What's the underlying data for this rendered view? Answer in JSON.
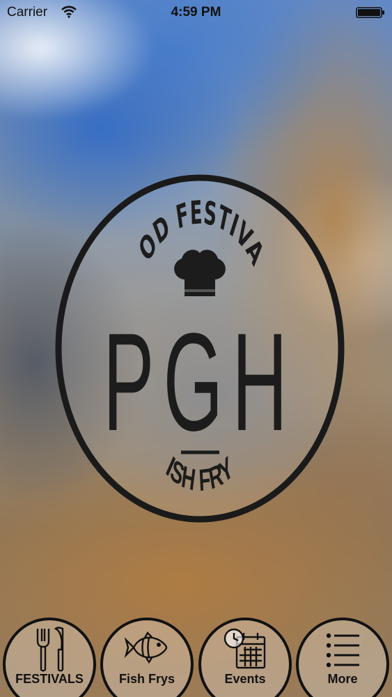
{
  "status_bar": {
    "carrier": "Carrier",
    "time": "4:59 PM",
    "wifi_icon": "wifi-icon",
    "battery_icon": "battery-full-icon"
  },
  "logo": {
    "top_text": "FOOD FESTIVALS",
    "main_text": "PGH",
    "bottom_text": "FISH FRYS",
    "icon": "chef-hat-icon"
  },
  "tab_bar": {
    "tabs": [
      {
        "label": "FESTIVALS",
        "icon": "fork-knife-icon"
      },
      {
        "label": "Fish Frys",
        "icon": "fish-icon"
      },
      {
        "label": "Events",
        "icon": "calendar-clock-icon"
      },
      {
        "label": "More",
        "icon": "list-icon"
      }
    ]
  },
  "colors": {
    "ink": "#111111",
    "sky": "#5f88c8",
    "wood": "#b07c42"
  }
}
